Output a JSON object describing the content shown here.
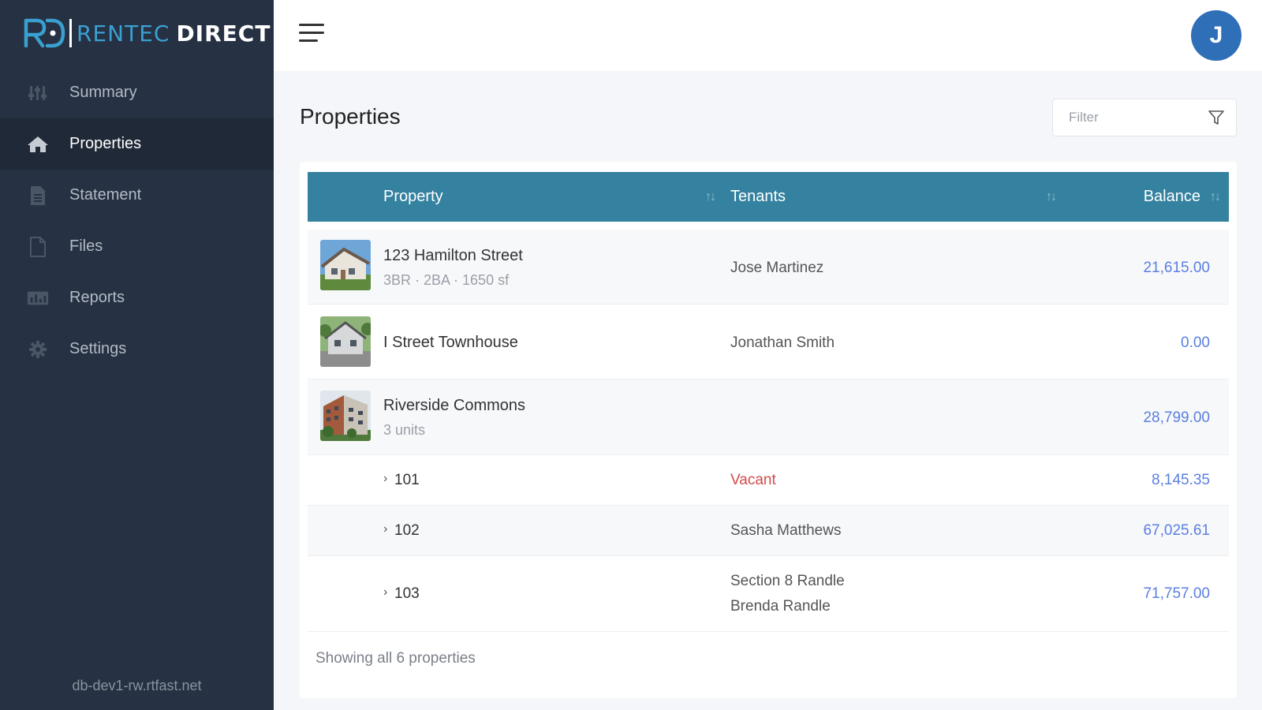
{
  "brand": {
    "name_part1": "RENTEC",
    "name_part2": "DIRECT"
  },
  "sidebar": {
    "items": [
      {
        "label": "Summary",
        "icon": "sliders-icon",
        "active": false
      },
      {
        "label": "Properties",
        "icon": "home-icon",
        "active": true
      },
      {
        "label": "Statement",
        "icon": "document-icon",
        "active": false
      },
      {
        "label": "Files",
        "icon": "file-icon",
        "active": false
      },
      {
        "label": "Reports",
        "icon": "report-icon",
        "active": false
      },
      {
        "label": "Settings",
        "icon": "gear-icon",
        "active": false
      }
    ],
    "server": "db-dev1-rw.rtfast.net"
  },
  "header": {
    "avatar_initial": "J"
  },
  "main": {
    "title": "Properties",
    "filter_placeholder": "Filter",
    "columns": {
      "property": "Property",
      "tenants": "Tenants",
      "balance": "Balance"
    },
    "rows": [
      {
        "name": "123 Hamilton Street",
        "sub": "3BR · 2BA · 1650 sf",
        "tenant": "Jose Martinez",
        "balance": "21,615.00",
        "thumb": "house-photo"
      },
      {
        "name": "I Street Townhouse",
        "sub": "",
        "tenant": "Jonathan Smith",
        "balance": "0.00",
        "thumb": "townhouse-photo"
      },
      {
        "name": "Riverside Commons",
        "sub": "3 units",
        "tenant": "",
        "balance": "28,799.00",
        "thumb": "apartment-photo"
      }
    ],
    "units": [
      {
        "name": "101",
        "tenant": "Vacant",
        "tenant2": "",
        "balance": "8,145.35",
        "vacant": true
      },
      {
        "name": "102",
        "tenant": "Sasha Matthews",
        "tenant2": "",
        "balance": "67,025.61",
        "vacant": false
      },
      {
        "name": "103",
        "tenant": "Section 8 Randle",
        "tenant2": "Brenda Randle",
        "balance": "71,757.00",
        "vacant": false
      }
    ],
    "footer": "Showing all 6 properties"
  },
  "colors": {
    "sidebar": "#263143",
    "header_row": "#3582a0",
    "balance_link": "#5b7fe0",
    "vacant": "#d24a4a",
    "avatar": "#2f6fb7"
  }
}
